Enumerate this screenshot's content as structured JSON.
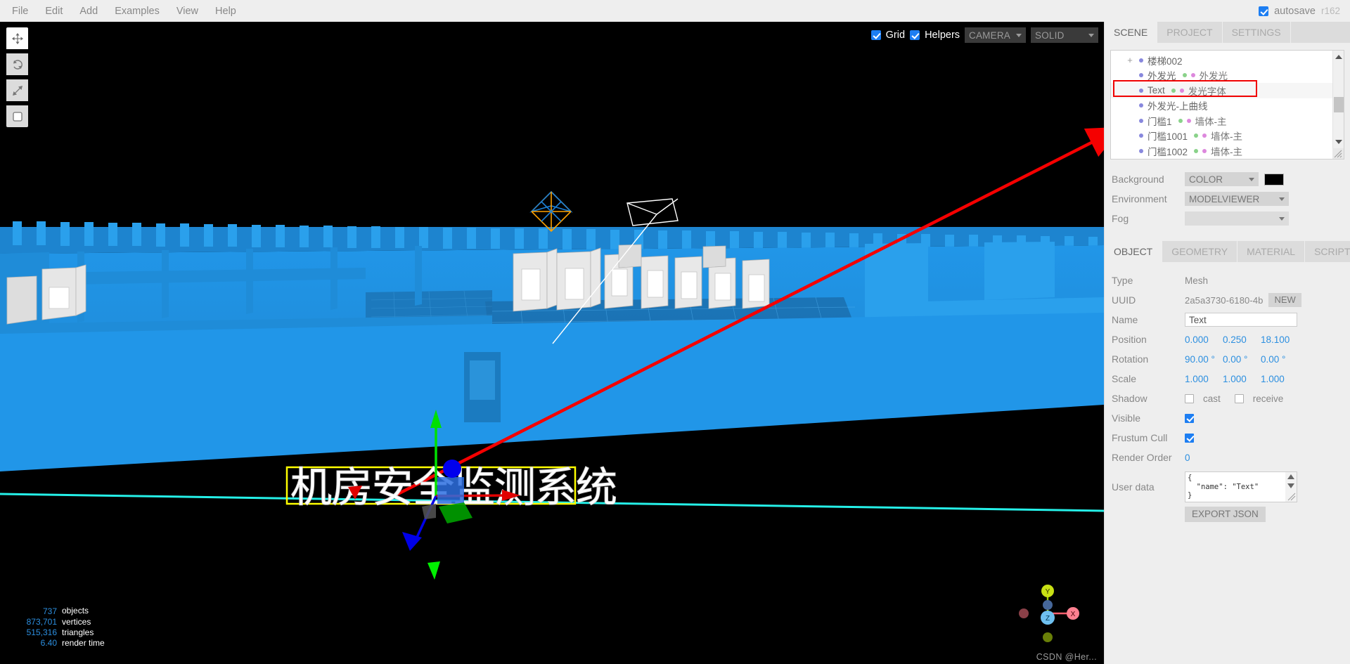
{
  "menubar": {
    "items": [
      {
        "label": "File",
        "name": "menu-file"
      },
      {
        "label": "Edit",
        "name": "menu-edit"
      },
      {
        "label": "Add",
        "name": "menu-add"
      },
      {
        "label": "Examples",
        "name": "menu-examples"
      },
      {
        "label": "View",
        "name": "menu-view"
      },
      {
        "label": "Help",
        "name": "menu-help"
      }
    ],
    "autosave_label": "autosave",
    "autosave_checked": true,
    "revision": "r162"
  },
  "viewport": {
    "tools": [
      {
        "name": "translate-tool",
        "icon": "move-icon",
        "active": true
      },
      {
        "name": "rotate-tool",
        "icon": "rotate-icon",
        "active": false
      },
      {
        "name": "scale-tool",
        "icon": "scale-icon",
        "active": false
      },
      {
        "name": "local-world-toggle",
        "icon": "square-icon",
        "active": false
      }
    ],
    "grid_label": "Grid",
    "grid_checked": true,
    "helpers_label": "Helpers",
    "helpers_checked": true,
    "camera_value": "CAMERA",
    "shading_value": "SOLID",
    "selected_text_object": "机房安全监测系统",
    "stats": [
      {
        "value": "737",
        "label": "objects"
      },
      {
        "value": "873,701",
        "label": "vertices"
      },
      {
        "value": "515,316",
        "label": "triangles"
      },
      {
        "value": "6.40",
        "label": "render time"
      }
    ],
    "axes": {
      "x": "X",
      "y": "Y",
      "z": "Z"
    },
    "watermark": "CSDN @Her..."
  },
  "sidebar": {
    "main_tabs": [
      {
        "label": "SCENE",
        "active": true
      },
      {
        "label": "PROJECT",
        "active": false
      },
      {
        "label": "SETTINGS",
        "active": false
      }
    ],
    "outliner": [
      {
        "expander": "+",
        "indent": 0,
        "label": "楼梯002",
        "sub": "",
        "selected": false,
        "has_geo": false,
        "has_mat": false
      },
      {
        "expander": "",
        "indent": 1,
        "label": "外发光",
        "sub": "外发光",
        "selected": false,
        "has_geo": true,
        "has_mat": true
      },
      {
        "expander": "",
        "indent": 1,
        "label": "Text",
        "sub": "发光字体",
        "selected": true,
        "has_geo": true,
        "has_mat": true
      },
      {
        "expander": "",
        "indent": 1,
        "label": "外发光-上曲线",
        "sub": "",
        "selected": false,
        "has_geo": false,
        "has_mat": false
      },
      {
        "expander": "",
        "indent": 1,
        "label": "门槛1",
        "sub": "墙体-主",
        "selected": false,
        "has_geo": true,
        "has_mat": true
      },
      {
        "expander": "",
        "indent": 1,
        "label": "门槛1001",
        "sub": "墙体-主",
        "selected": false,
        "has_geo": true,
        "has_mat": true
      },
      {
        "expander": "",
        "indent": 1,
        "label": "门槛1002",
        "sub": "墙体-主",
        "selected": false,
        "has_geo": true,
        "has_mat": true
      }
    ],
    "scene": {
      "background_label": "Background",
      "background_type": "COLOR",
      "background_color": "#000000",
      "environment_label": "Environment",
      "environment_type": "MODELVIEWER",
      "fog_label": "Fog",
      "fog_type": ""
    },
    "object_tabs": [
      {
        "label": "OBJECT",
        "active": true
      },
      {
        "label": "GEOMETRY",
        "active": false
      },
      {
        "label": "MATERIAL",
        "active": false
      },
      {
        "label": "SCRIPT",
        "active": false
      }
    ],
    "object": {
      "type_label": "Type",
      "type_value": "Mesh",
      "uuid_label": "UUID",
      "uuid_value": "2a5a3730-6180-4b",
      "uuid_new_button": "NEW",
      "name_label": "Name",
      "name_value": "Text",
      "position_label": "Position",
      "position": [
        "0.000",
        "0.250",
        "18.100"
      ],
      "rotation_label": "Rotation",
      "rotation": [
        "90.00 °",
        "0.00 °",
        "0.00 °"
      ],
      "scale_label": "Scale",
      "scale": [
        "1.000",
        "1.000",
        "1.000"
      ],
      "shadow_label": "Shadow",
      "shadow_cast_label": "cast",
      "shadow_cast_checked": false,
      "shadow_receive_label": "receive",
      "shadow_receive_checked": false,
      "visible_label": "Visible",
      "visible_checked": true,
      "frustum_label": "Frustum Cull",
      "frustum_checked": true,
      "render_order_label": "Render Order",
      "render_order_value": "0",
      "userdata_label": "User data",
      "userdata_value": "{\n  \"name\": \"Text\"\n}",
      "export_json_label": "EXPORT JSON"
    }
  }
}
